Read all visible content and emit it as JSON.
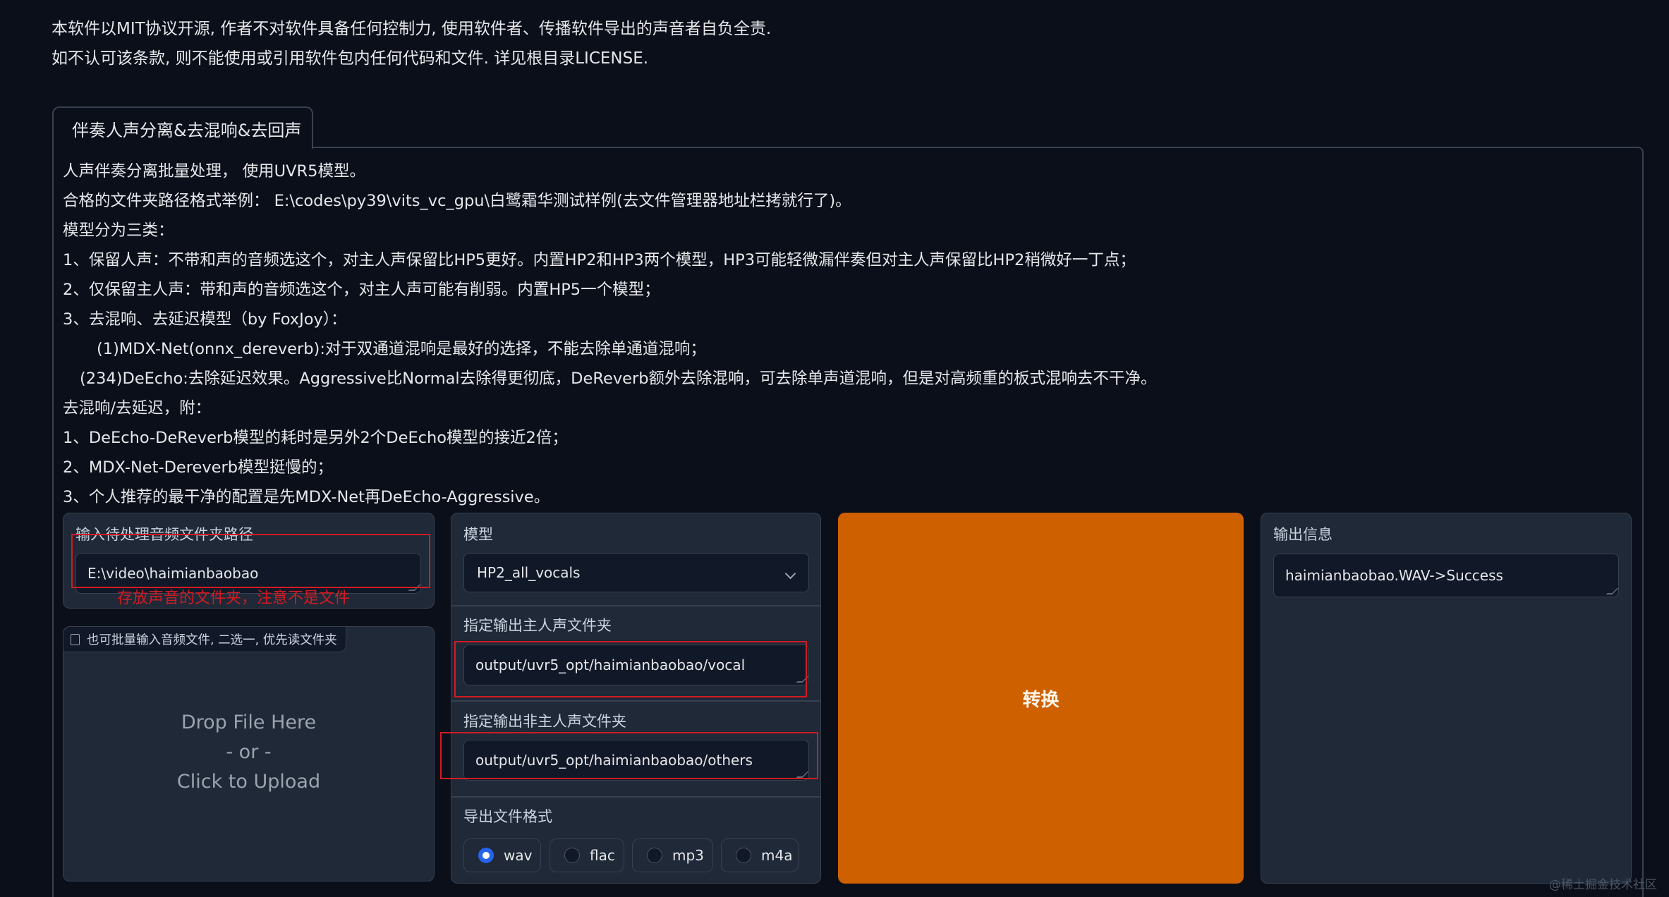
{
  "notice": {
    "line1": "本软件以MIT协议开源, 作者不对软件具备任何控制力, 使用软件者、传播软件导出的声音者自负全责.",
    "line2": "如不认可该条款, 则不能使用或引用软件包内任何代码和文件. 详见根目录LICENSE."
  },
  "tab": {
    "label": "伴奏人声分离&去混响&去回声"
  },
  "description": [
    "人声伴奏分离批量处理， 使用UVR5模型。",
    "合格的文件夹路径格式举例： E:\\codes\\py39\\vits_vc_gpu\\白鹭霜华测试样例(去文件管理器地址栏拷就行了)。",
    "模型分为三类：",
    "1、保留人声：不带和声的音频选这个，对主人声保留比HP5更好。内置HP2和HP3两个模型，HP3可能轻微漏伴奏但对主人声保留比HP2稍微好一丁点；",
    "2、仅保留主人声：带和声的音频选这个，对主人声可能有削弱。内置HP5一个模型；",
    "3、去混响、去延迟模型（by FoxJoy）：",
    "(1)MDX-Net(onnx_dereverb):对于双通道混响是最好的选择，不能去除单通道混响；",
    "(234)DeEcho:去除延迟效果。Aggressive比Normal去除得更彻底，DeReverb额外去除混响，可去除单声道混响，但是对高频重的板式混响去不干净。",
    "去混响/去延迟，附：",
    "1、DeEcho-DeReverb模型的耗时是另外2个DeEcho模型的接近2倍；",
    "2、MDX-Net-Dereverb模型挺慢的；",
    "3、个人推荐的最干净的配置是先MDX-Net再DeEcho-Aggressive。"
  ],
  "input_dir": {
    "label": "输入待处理音频文件夹路径",
    "value": "E:\\video\\haimianbaobao",
    "annotation": "存放声音的文件夹，注意不是文件"
  },
  "upload": {
    "label": "也可批量输入音频文件, 二选一, 优先读文件夹",
    "drop_line1": "Drop File Here",
    "drop_line2": "- or -",
    "drop_line3": "Click to Upload"
  },
  "model": {
    "label": "模型",
    "selected": "HP2_all_vocals"
  },
  "vocal_out": {
    "label": "指定输出主人声文件夹",
    "value": "output/uvr5_opt/haimianbaobao/vocal"
  },
  "others_out": {
    "label": "指定输出非主人声文件夹",
    "value": "output/uvr5_opt/haimianbaobao/others"
  },
  "format": {
    "label": "导出文件格式",
    "options": [
      "wav",
      "flac",
      "mp3",
      "m4a"
    ],
    "selected": "wav"
  },
  "convert": {
    "label": "转换"
  },
  "output": {
    "label": "输出信息",
    "value": "haimianbaobao.WAV->Success"
  },
  "watermark": "@稀土掘金技术社区",
  "colors": {
    "accent": "#cf6000",
    "annotation_red": "#d21b23",
    "radio_blue": "#2563eb",
    "background": "#0b0f19"
  }
}
